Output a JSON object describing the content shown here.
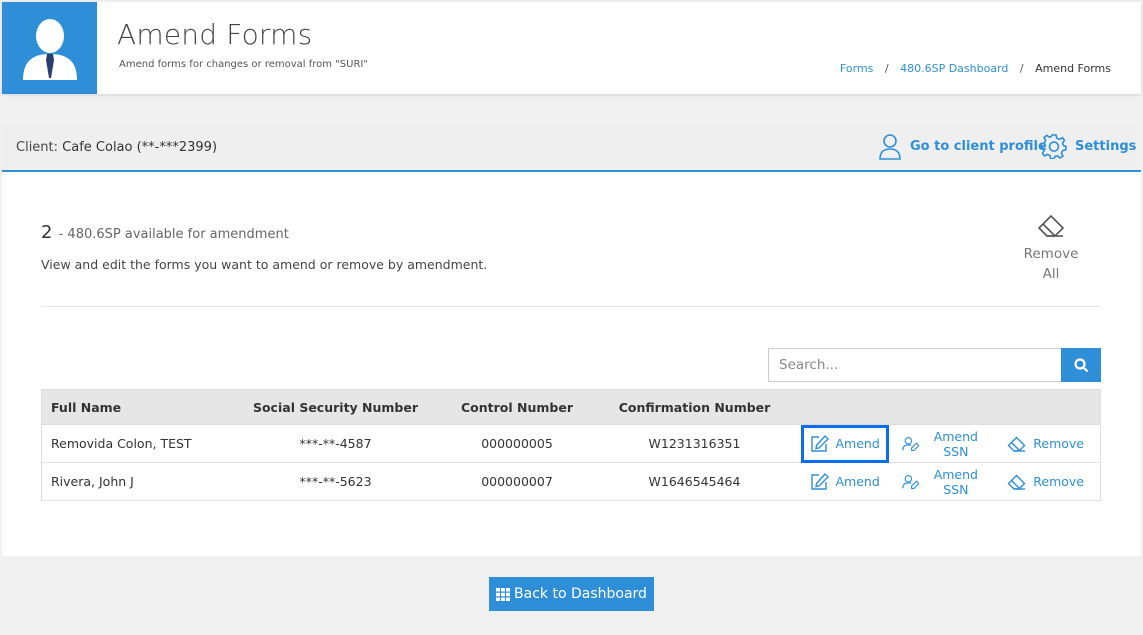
{
  "header": {
    "title": "Amend Forms",
    "subtitle": "Amend forms for changes or removal from \"SURI\"",
    "avatar_icon": "user-tie-icon",
    "brand_color": "#2e8fd8"
  },
  "breadcrumb": [
    {
      "label": "Forms"
    },
    {
      "label": "480.6SP Dashboard"
    },
    {
      "label": "Amend Forms"
    }
  ],
  "breadcrumb_separator": "/",
  "client_bar": {
    "client_label": "Client:",
    "client_name": "Cafe Colao (**-***2399)",
    "profile_link": "Go to client profile",
    "settings_link": "Settings"
  },
  "summary": {
    "count": "2",
    "count_text": "- 480.6SP available for amendment",
    "description": "View and edit the forms you want to amend or remove by amendment.",
    "remove_all_line1": "Remove",
    "remove_all_line2": "All"
  },
  "search": {
    "placeholder": "Search..."
  },
  "table": {
    "columns": [
      "Full Name",
      "Social Security Number",
      "Control Number",
      "Confirmation Number",
      ""
    ],
    "rows": [
      {
        "full_name": "Removida Colon, TEST",
        "ssn": "***-**-4587",
        "control": "000000005",
        "confirmation": "W1231316351"
      },
      {
        "full_name": "Rivera, John J",
        "ssn": "***-**-5623",
        "control": "000000007",
        "confirmation": "W1646545464"
      }
    ],
    "actions": {
      "amend": "Amend",
      "amend_ssn": "Amend SSN",
      "remove": "Remove"
    }
  },
  "footer": {
    "back_button": "Back to Dashboard"
  }
}
